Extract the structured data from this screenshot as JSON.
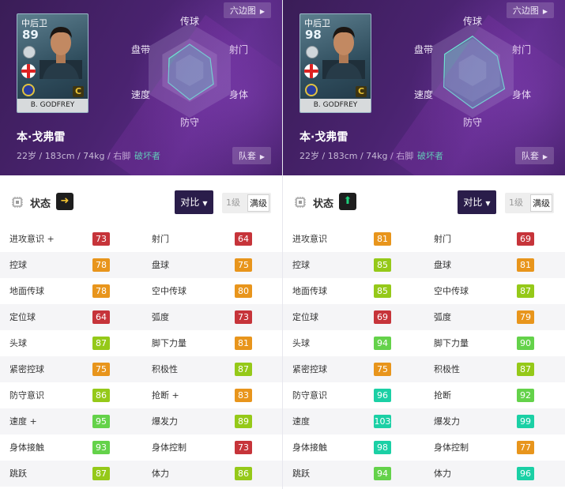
{
  "panels": [
    {
      "card": {
        "position": "中后卫",
        "rating": "89",
        "name": "B. GODFREY",
        "tier": "C"
      },
      "radar": {
        "top": "传球",
        "top_right": "射门",
        "bottom_right": "身体",
        "bottom": "防守",
        "bottom_left": "速度",
        "top_left": "盘带",
        "values": [
          0.55,
          0.5,
          0.58,
          0.62,
          0.52,
          0.5
        ]
      },
      "hex_button": "六边图",
      "player_name": "本·戈弗雷",
      "player_info": "22岁 / 183cm / 74kg / 右脚",
      "player_type": "破坏者",
      "kit_button": "队套",
      "status": {
        "label": "状态",
        "arrow": "➜",
        "arrow_dir": "right"
      },
      "compare_button": "对比",
      "level": {
        "lv1": "1级",
        "max": "满级"
      },
      "stats": [
        {
          "l": "进攻意识 +",
          "lv": "73",
          "lc": "red",
          "r": "射门",
          "rv": "64",
          "rc": "red"
        },
        {
          "l": "控球",
          "lv": "78",
          "lc": "orange",
          "r": "盘球",
          "rv": "75",
          "rc": "orange"
        },
        {
          "l": "地面传球",
          "lv": "78",
          "lc": "orange",
          "r": "空中传球",
          "rv": "80",
          "rc": "orange"
        },
        {
          "l": "定位球",
          "lv": "64",
          "lc": "red",
          "r": "弧度",
          "rv": "73",
          "rc": "red"
        },
        {
          "l": "头球",
          "lv": "87",
          "lc": "yg",
          "r": "脚下力量",
          "rv": "81",
          "rc": "orange"
        },
        {
          "l": "紧密控球",
          "lv": "75",
          "lc": "orange",
          "r": "积极性",
          "rv": "87",
          "rc": "yg"
        },
        {
          "l": "防守意识",
          "lv": "86",
          "lc": "yg",
          "r": "抢断 +",
          "rv": "83",
          "rc": "orange"
        },
        {
          "l": "速度 +",
          "lv": "95",
          "lc": "green",
          "r": "爆发力",
          "rv": "89",
          "rc": "yg"
        },
        {
          "l": "身体接触",
          "lv": "93",
          "lc": "green",
          "r": "身体控制",
          "rv": "73",
          "rc": "red"
        },
        {
          "l": "跳跃",
          "lv": "87",
          "lc": "yg",
          "r": "体力",
          "rv": "86",
          "rc": "yg"
        }
      ]
    },
    {
      "card": {
        "position": "中后卫",
        "rating": "98",
        "name": "B. GODFREY",
        "tier": "C"
      },
      "radar": {
        "top": "传球",
        "top_right": "射门",
        "bottom_right": "身体",
        "bottom": "防守",
        "bottom_left": "速度",
        "top_left": "盘带",
        "values": [
          0.72,
          0.6,
          0.78,
          0.8,
          0.7,
          0.68
        ]
      },
      "hex_button": "六边图",
      "player_name": "本·戈弗雷",
      "player_info": "22岁 / 183cm / 74kg / 右脚",
      "player_type": "破坏者",
      "kit_button": "队套",
      "status": {
        "label": "状态",
        "arrow": "⬆",
        "arrow_dir": "up"
      },
      "compare_button": "对比",
      "level": {
        "lv1": "1级",
        "max": "满级"
      },
      "stats": [
        {
          "l": "进攻意识",
          "lv": "81",
          "lc": "orange",
          "r": "射门",
          "rv": "69",
          "rc": "red"
        },
        {
          "l": "控球",
          "lv": "85",
          "lc": "yg",
          "r": "盘球",
          "rv": "81",
          "rc": "orange"
        },
        {
          "l": "地面传球",
          "lv": "85",
          "lc": "yg",
          "r": "空中传球",
          "rv": "87",
          "rc": "yg"
        },
        {
          "l": "定位球",
          "lv": "69",
          "lc": "red",
          "r": "弧度",
          "rv": "79",
          "rc": "orange"
        },
        {
          "l": "头球",
          "lv": "94",
          "lc": "green",
          "r": "脚下力量",
          "rv": "90",
          "rc": "green"
        },
        {
          "l": "紧密控球",
          "lv": "75",
          "lc": "orange",
          "r": "积极性",
          "rv": "87",
          "rc": "yg"
        },
        {
          "l": "防守意识",
          "lv": "96",
          "lc": "teal",
          "r": "抢断",
          "rv": "92",
          "rc": "green"
        },
        {
          "l": "速度",
          "lv": "103",
          "lc": "teal",
          "r": "爆发力",
          "rv": "99",
          "rc": "teal"
        },
        {
          "l": "身体接触",
          "lv": "98",
          "lc": "teal",
          "r": "身体控制",
          "rv": "77",
          "rc": "orange"
        },
        {
          "l": "跳跃",
          "lv": "94",
          "lc": "green",
          "r": "体力",
          "rv": "96",
          "rc": "teal"
        }
      ]
    }
  ]
}
